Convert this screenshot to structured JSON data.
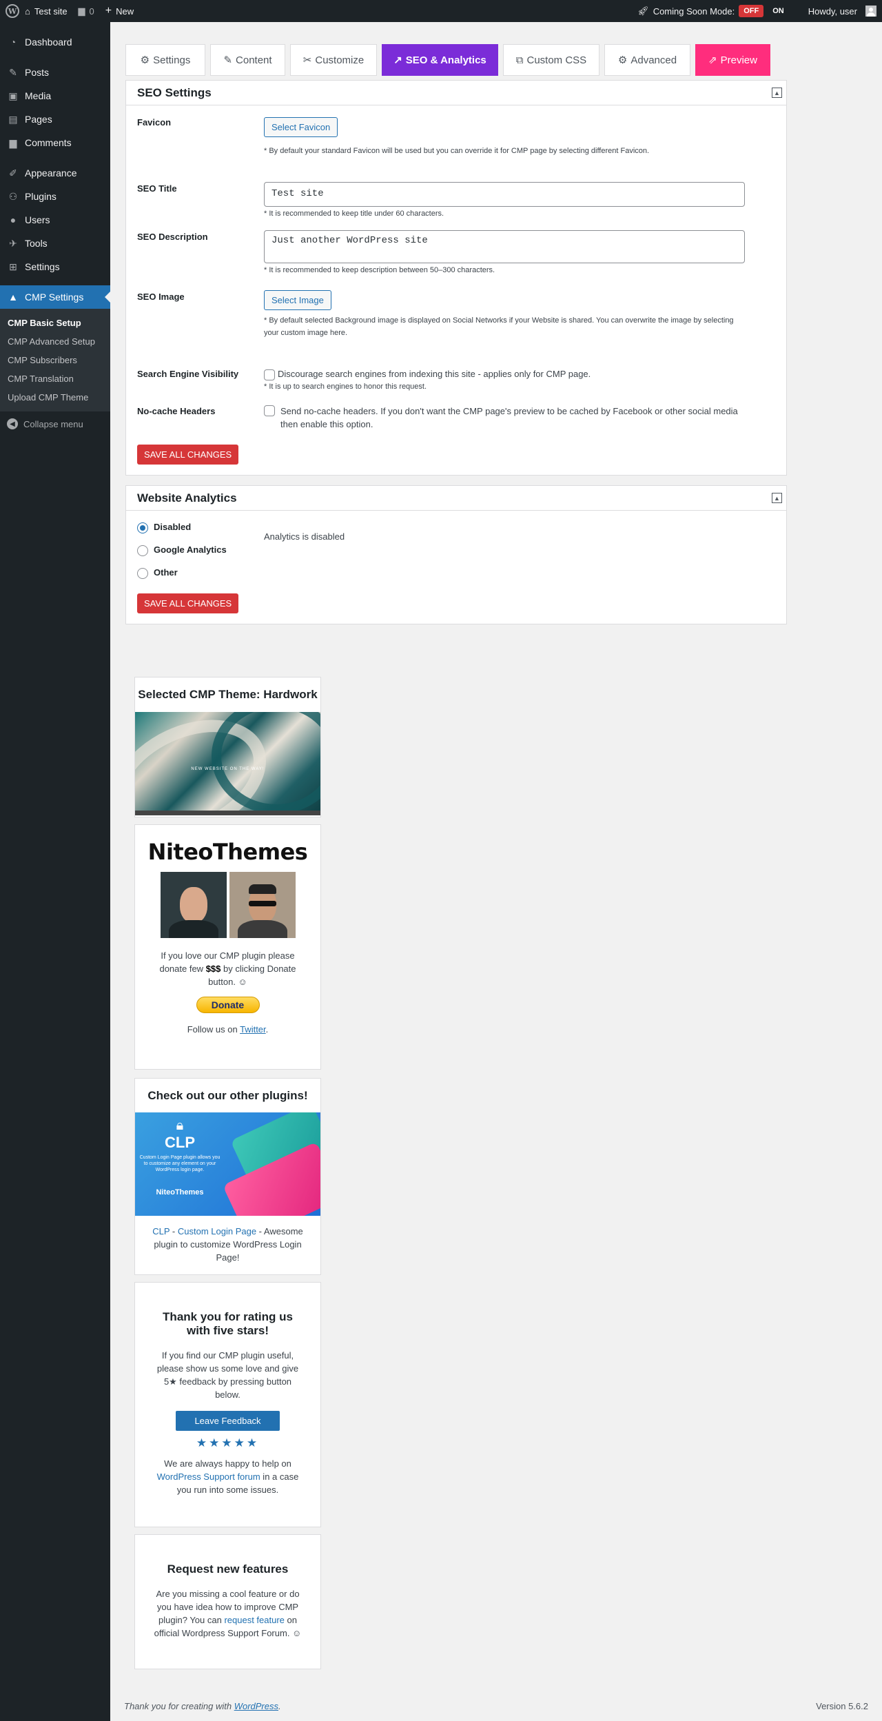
{
  "adminbar": {
    "site_name": "Test site",
    "comments_count": "0",
    "new_label": "New",
    "coming_soon_label": "Coming Soon Mode:",
    "off_label": "OFF",
    "on_label": "ON",
    "howdy": "Howdy, user"
  },
  "sidebar": {
    "items": [
      {
        "label": "Dashboard",
        "icon": "dashboard-icon"
      },
      {
        "label": "Posts",
        "icon": "pin-icon"
      },
      {
        "label": "Media",
        "icon": "media-icon"
      },
      {
        "label": "Pages",
        "icon": "pages-icon"
      },
      {
        "label": "Comments",
        "icon": "comment-icon"
      },
      {
        "label": "Appearance",
        "icon": "brush-icon"
      },
      {
        "label": "Plugins",
        "icon": "plug-icon"
      },
      {
        "label": "Users",
        "icon": "user-icon"
      },
      {
        "label": "Tools",
        "icon": "wrench-icon"
      },
      {
        "label": "Settings",
        "icon": "settings-icon"
      },
      {
        "label": "CMP Settings",
        "icon": "rocket-icon"
      }
    ],
    "submenu": [
      "CMP Basic Setup",
      "CMP Advanced Setup",
      "CMP Subscribers",
      "CMP Translation",
      "Upload CMP Theme"
    ],
    "collapse": "Collapse menu"
  },
  "tabs": [
    {
      "label": "Settings",
      "icon": "gear-icon"
    },
    {
      "label": "Content",
      "icon": "edit-icon"
    },
    {
      "label": "Customize",
      "icon": "tools-icon"
    },
    {
      "label": "SEO & Analytics",
      "icon": "chart-icon"
    },
    {
      "label": "Custom CSS",
      "icon": "css-icon"
    },
    {
      "label": "Advanced",
      "icon": "gears-icon"
    },
    {
      "label": "Preview",
      "icon": "external-icon"
    }
  ],
  "seo": {
    "title": "SEO Settings",
    "favicon_label": "Favicon",
    "favicon_button": "Select Favicon",
    "favicon_note": "* By default your standard Favicon will be used but you can override it for CMP page by selecting different Favicon.",
    "seo_title_label": "SEO Title",
    "seo_title_value": "Test site",
    "seo_title_note": "* It is recommended to keep title under 60 characters.",
    "seo_desc_label": "SEO Description",
    "seo_desc_value": "Just another WordPress site",
    "seo_desc_note": "* It is recommended to keep description between 50–300 characters.",
    "seo_image_label": "SEO Image",
    "seo_image_button": "Select Image",
    "seo_image_note": "* By default selected Background image is displayed on Social Networks if your Website is shared. You can overwrite the image by selecting your custom image here.",
    "visibility_label": "Search Engine Visibility",
    "visibility_text": "Discourage search engines from indexing this site - applies only for CMP page.",
    "visibility_note": "* It is up to search engines to honor this request.",
    "nocache_label": "No-cache Headers",
    "nocache_text": "Send no-cache headers. If you don't want the CMP page's preview to be cached by Facebook or other social media then enable this option.",
    "save_label": "SAVE ALL CHANGES"
  },
  "analytics": {
    "title": "Website Analytics",
    "options": [
      "Disabled",
      "Google Analytics",
      "Other"
    ],
    "selected": "Disabled",
    "status": "Analytics is disabled",
    "save_label": "SAVE ALL CHANGES"
  },
  "widgets": {
    "theme_title": "Selected CMP Theme: Hardwork",
    "theme_caption": "NEW WEBSITE ON THE WAY!",
    "niteo_logo": "NiteoThemes",
    "niteo_text_a": "If you love our CMP plugin please donate few ",
    "niteo_money": "$$$",
    "niteo_text_b": " by clicking Donate button. ☺",
    "donate_label": "Donate",
    "follow_text": "Follow us on ",
    "twitter_label": "Twitter",
    "plugins_title": "Check out our other plugins!",
    "clp_big": "CLP",
    "clp_small": "Custom Login Page plugin allows you to customize any element on your WordPress login page.",
    "clp_brand": "NiteoThemes",
    "clp_link_a": "CLP",
    "clp_link_b": "Custom Login Page",
    "clp_desc": "Awesome plugin to customize WordPress Login Page!",
    "rating_title": "Thank you for rating us with five stars!",
    "rating_text": "If you find our CMP plugin useful, please show us some love and give 5★ feedback by pressing button below.",
    "feedback_label": "Leave Feedback",
    "stars": "★★★★★",
    "help_a": "We are always happy to help on ",
    "help_link": "WordPress Support forum",
    "help_b": " in a case you run into some issues.",
    "features_title": "Request new features",
    "features_a": "Are you missing a cool feature or do you have idea how to improve CMP plugin? You can ",
    "features_link": "request feature",
    "features_b": " on official Wordpress Support Forum. ☺"
  },
  "footer": {
    "text": "Thank you for creating with ",
    "link": "WordPress",
    "version": "Version 5.6.2"
  }
}
